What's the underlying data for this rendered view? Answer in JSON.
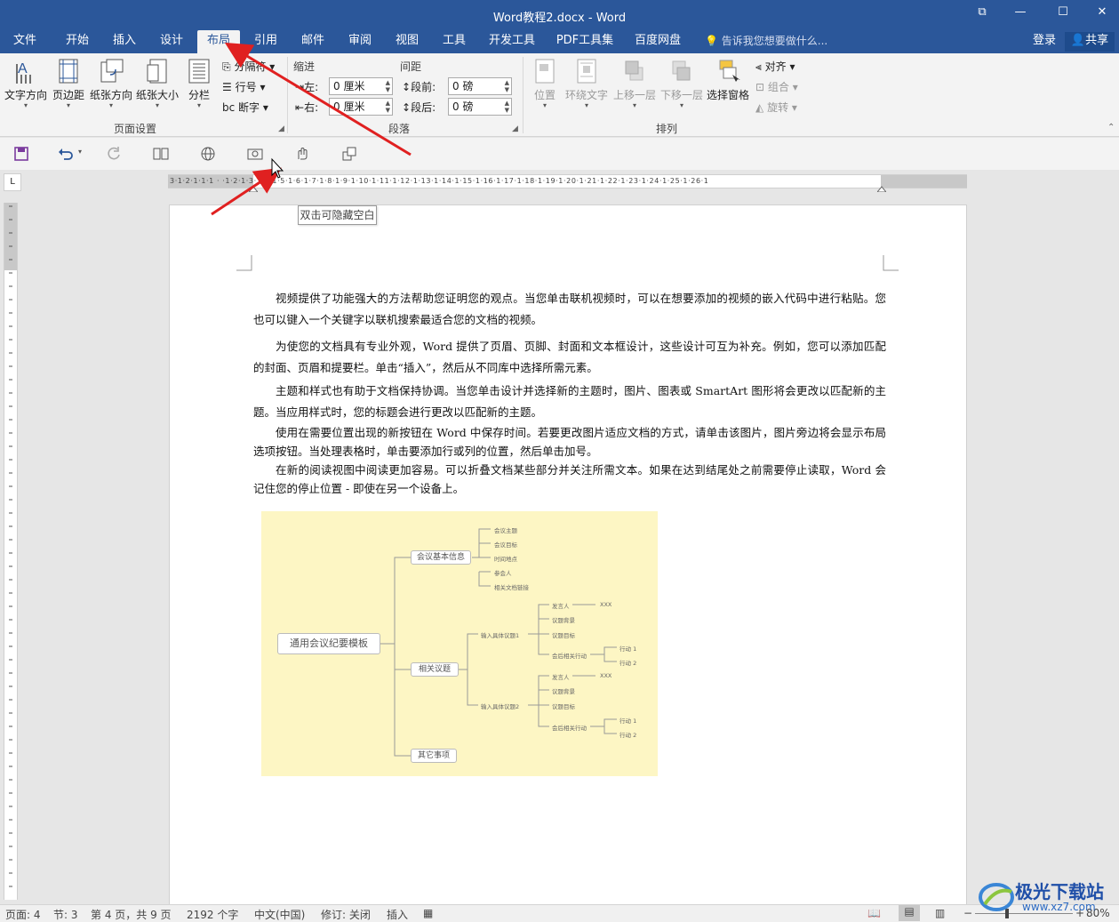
{
  "window": {
    "title": "Word教程2.docx - Word",
    "restore_glyph": "⧉",
    "minimize_glyph": "—",
    "maximize_glyph": "☐",
    "close_glyph": "✕"
  },
  "tabs": [
    {
      "label": "文件"
    },
    {
      "label": "开始"
    },
    {
      "label": "插入"
    },
    {
      "label": "设计"
    },
    {
      "label": "布局",
      "active": true
    },
    {
      "label": "引用"
    },
    {
      "label": "邮件"
    },
    {
      "label": "审阅"
    },
    {
      "label": "视图"
    },
    {
      "label": "工具"
    },
    {
      "label": "开发工具"
    },
    {
      "label": "PDF工具集"
    },
    {
      "label": "百度网盘"
    }
  ],
  "tellme": "告诉我您想要做什么...",
  "login": "登录",
  "share": "共享",
  "ribbon": {
    "page_setup": {
      "text_direction": "文字方向",
      "margins": "页边距",
      "orientation": "纸张方向",
      "size": "纸张大小",
      "columns": "分栏",
      "breaks": "分隔符",
      "line_numbers": "行号",
      "hyphenation": "断字",
      "group_label": "页面设置"
    },
    "paragraph": {
      "indent_title": "缩进",
      "spacing_title": "间距",
      "left_label": "左:",
      "right_label": "右:",
      "left_value": "0 厘米",
      "right_value": "0 厘米",
      "before_label": "段前:",
      "after_label": "段后:",
      "before_value": "0 磅",
      "after_value": "0 磅",
      "group_label": "段落"
    },
    "arrange": {
      "position": "位置",
      "wrap_text": "环绕文字",
      "bring_forward": "上移一层",
      "send_backward": "下移一层",
      "selection_pane": "选择窗格",
      "align": "对齐",
      "group": "组合",
      "rotate": "旋转",
      "group_label": "排列"
    }
  },
  "tooltip": "双击可隐藏空白",
  "ruler": {
    "h_ticks": "3·1·2·1·1·1 · ·1·2·1·3·1·4·1·5·1·6·1·7·1·8·1·9·1·10·1·11·1·12·1·13·1·14·1·15·1·16·1·17·1·18·1·19·1·20·1·21·1·22·1·23·1·24·1·25·1·26·1",
    "corner": "L"
  },
  "document": {
    "paragraphs": [
      "视频提供了功能强大的方法帮助您证明您的观点。当您单击联机视频时，可以在想要添加的视频的嵌入代码中进行粘贴。您也可以键入一个关键字以联机搜索最适合您的文档的视频。",
      "为使您的文档具有专业外观，Word 提供了页眉、页脚、封面和文本框设计，这些设计可互为补充。例如，您可以添加匹配的封面、页眉和提要栏。单击“插入”，然后从不同库中选择所需元素。",
      "主题和样式也有助于文档保持协调。当您单击设计并选择新的主题时，图片、图表或 SmartArt 图形将会更改以匹配新的主题。当应用样式时，您的标题会进行更改以匹配新的主题。",
      "使用在需要位置出现的新按钮在 Word 中保存时间。若要更改图片适应文档的方式，请单击该图片，图片旁边将会显示布局选项按钮。当处理表格时，单击要添加行或列的位置，然后单击加号。",
      "在新的阅读视图中阅读更加容易。可以折叠文档某些部分并关注所需文本。如果在达到结尾处之前需要停止读取，Word 会记住您的停止位置 - 即使在另一个设备上。"
    ]
  },
  "mindmap": {
    "root": "通用会议纪要模板",
    "basic_info": "会议基本信息",
    "basic_items": [
      "会议主题",
      "会议目标",
      "时间地点",
      "参会人",
      "相关文档链接"
    ],
    "topics": "相关议题",
    "topic1": "输入具体议题1",
    "topic2": "输入具体议题2",
    "topic_items": [
      "发言人",
      "议题背景",
      "议题目标",
      "会后相关行动"
    ],
    "speaker_value": "XXX",
    "actions": [
      "行动 1",
      "行动 2"
    ],
    "other": "其它事项"
  },
  "statusbar": {
    "page": "页面: 4",
    "section": "节: 3",
    "page_of": "第 4 页，共 9 页",
    "words": "2192 个字",
    "language": "中文(中国)",
    "track": "修订: 关闭",
    "insert": "插入",
    "zoom": "80%"
  },
  "watermark": {
    "text": "极光下载站",
    "url": "www.xz7.com"
  },
  "colors": {
    "accent": "#2b579a",
    "annotation": "#e02020",
    "mindmap_bg": "#fdf6c4"
  }
}
